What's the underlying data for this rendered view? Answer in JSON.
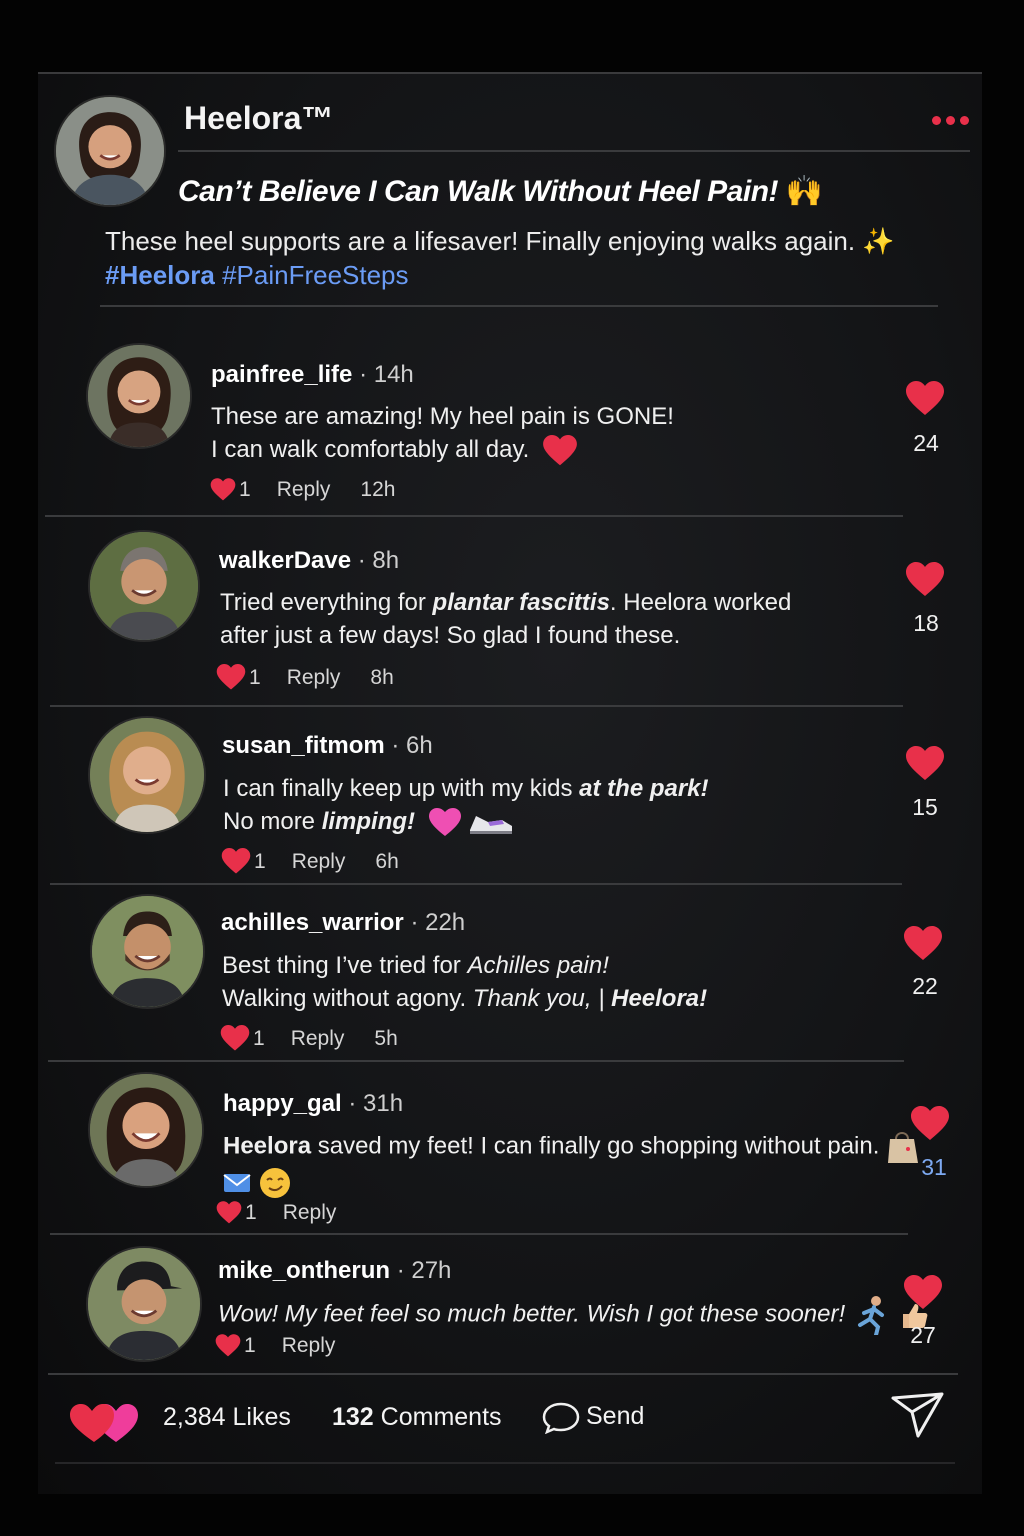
{
  "post": {
    "author": "Heelora™",
    "headline": "Can’t Believe I Can Walk Without Heel Pain!",
    "headline_emoji": "🙌",
    "text": "These heel supports are a lifesaver! Finally enjoying walks again.",
    "text_emoji": "✨",
    "hashtag_1": "#Heelora",
    "hashtag_2": "#PainFreeSteps"
  },
  "comments": [
    {
      "user": "painfree_life",
      "time": "· 14h",
      "line1": "These are amazing! My heel pain is GONE!",
      "line2": "I can walk comfortably all day.",
      "foot_likes": "1",
      "reply": "Reply",
      "ago": "12h",
      "likes": "24"
    },
    {
      "user": "walkerDave",
      "time": "· 8h",
      "line1_a": "Tried everything for ",
      "line1_b": "plantar fascittis",
      "line1_c": ". Heelora worked",
      "line2": "after just a few days! So glad I found these.",
      "foot_likes": "1",
      "reply": "Reply",
      "ago": "8h",
      "likes": "18"
    },
    {
      "user": "susan_fitmom",
      "time": "· 6h",
      "line1_a": "I can finally keep up with my kids ",
      "line1_b": "at the park!",
      "line2_a": "No more ",
      "line2_b": "limping!",
      "foot_likes": "1",
      "reply": "Reply",
      "ago": "6h",
      "likes": "15"
    },
    {
      "user": "achilles_warrior",
      "time": "· 22h",
      "line1_a": "Best thing I’ve tried for ",
      "line1_b": "Achilles pain!",
      "line2_a": "Walking without agony. ",
      "line2_b": "Thank you, | ",
      "line2_c": "Heelora!",
      "foot_likes": "1",
      "reply": "Reply",
      "ago": "5h",
      "likes": "22"
    },
    {
      "user": "happy_gal",
      "time": "· 31h",
      "line1_a": "Heelora",
      "line1_b": " saved my feet! I can finally go shopping without pain.",
      "foot_likes": "1",
      "reply": "Reply",
      "likes": "31"
    },
    {
      "user": "mike_ontherun",
      "time": "· 27h",
      "line1": "Wow! My feet feel so much better. Wish I got these sooner!",
      "foot_likes": "1",
      "reply": "Reply",
      "likes": "27"
    }
  ],
  "footer": {
    "likes": "2,384 Likes",
    "comments_count": "132",
    "comments_label": " Comments",
    "send": "Send"
  },
  "colors": {
    "background": "#030303",
    "heart": "#e8304a",
    "hashtag": "#6b9cf5",
    "highlight_count": "#7eaaf2"
  },
  "icons": [
    "more-icon",
    "heart-icon",
    "comment-bubble-icon",
    "send-icon"
  ]
}
